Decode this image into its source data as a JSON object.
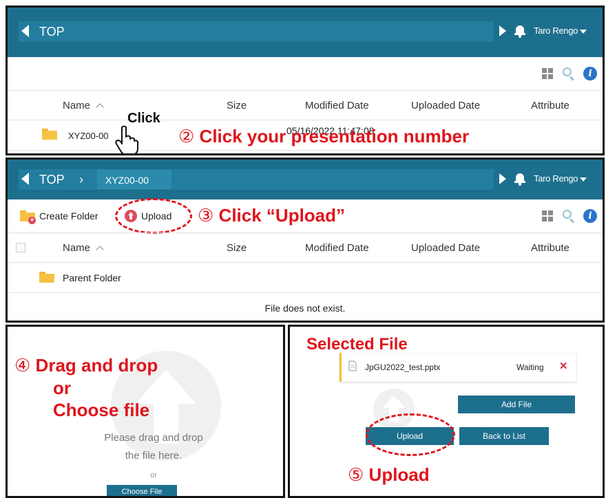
{
  "panel1": {
    "header": {
      "title": "TOP",
      "user": "Taro Rengo"
    },
    "columns": [
      "Name",
      "Size",
      "Modified Date",
      "Uploaded Date",
      "Attribute"
    ],
    "row": {
      "name": "XYZ00-00",
      "modified": "05/16/2022 11:47:08"
    },
    "click_label": "Click",
    "step": {
      "number": "②",
      "text": "Click your presentation number"
    }
  },
  "panel2": {
    "header": {
      "title": "TOP",
      "breadcrumb_sep": "›",
      "crumb": "XYZ00-00",
      "user": "Taro Rengo"
    },
    "toolbar": {
      "create_folder": "Create Folder",
      "upload": "Upload"
    },
    "columns": [
      "Name",
      "Size",
      "Modified Date",
      "Uploaded Date",
      "Attribute"
    ],
    "parent_folder": "Parent Folder",
    "empty": "File does not exist.",
    "step": {
      "number": "③",
      "text": "Click “Upload”"
    }
  },
  "panel3": {
    "step": {
      "number": "④",
      "line1": "Drag and drop",
      "line2": "or",
      "line3": "Choose file"
    },
    "drop_text_1": "Please drag and drop",
    "drop_text_2": "the file here.",
    "or": "or",
    "choose_file": "Choose File"
  },
  "panel4": {
    "selected_label": "Selected File",
    "file_name": "JpGU2022_test.pptx",
    "status": "Waiting",
    "remove": "✕",
    "add_file": "Add File",
    "upload": "Upload",
    "back": "Back to List",
    "step": {
      "number": "⑤",
      "text": "Upload"
    }
  },
  "colors": {
    "header": "#1d6f8e",
    "accent_red": "#e0141c",
    "folder": "#f6c244"
  }
}
